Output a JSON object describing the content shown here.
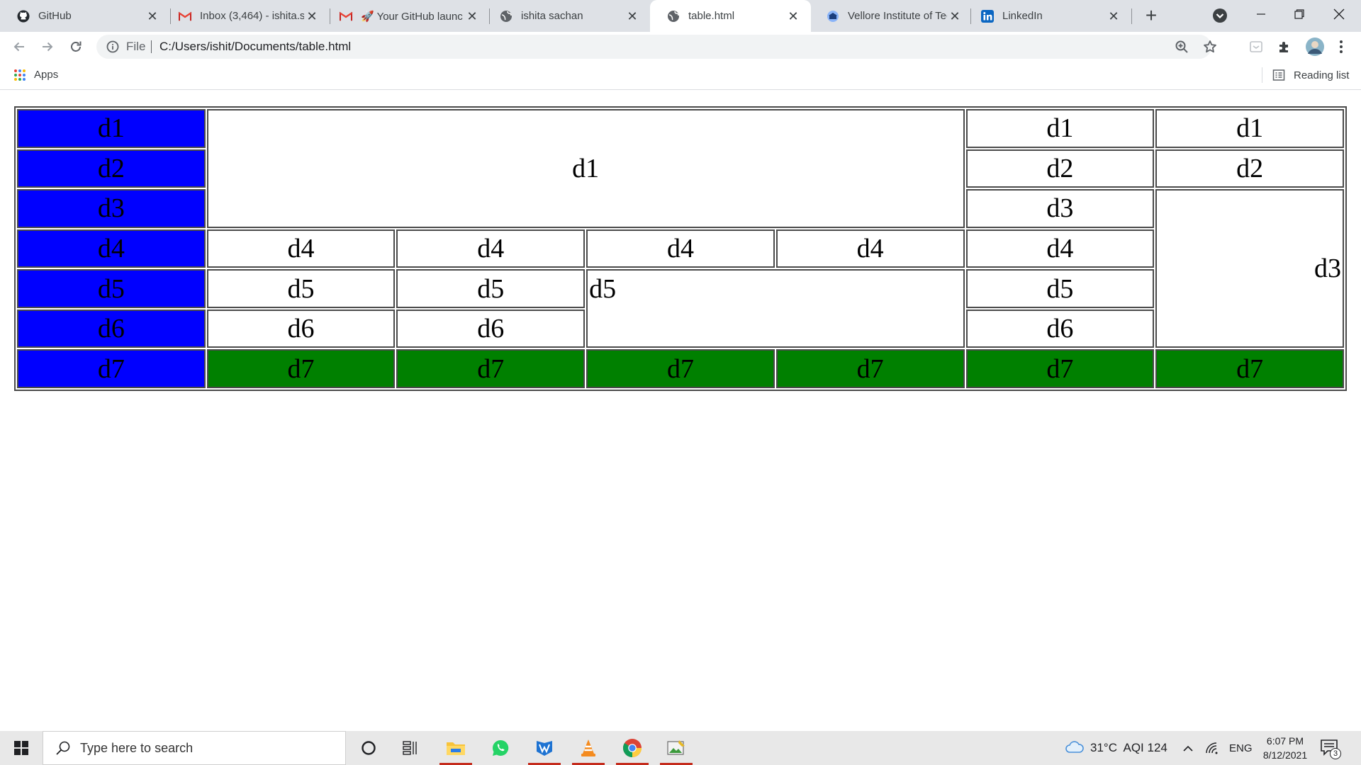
{
  "browser": {
    "tabs": [
      {
        "title": "GitHub",
        "favicon": "github-icon"
      },
      {
        "title": "Inbox (3,464) - ishita.s",
        "favicon": "gmail-icon"
      },
      {
        "title": "🚀 Your GitHub launc",
        "favicon": "gmail-icon"
      },
      {
        "title": "ishita sachan",
        "favicon": "globe-icon"
      },
      {
        "title": "table.html",
        "favicon": "globe-icon",
        "active": true
      },
      {
        "title": "Vellore Institute of Tec",
        "favicon": "vit-icon"
      },
      {
        "title": "LinkedIn",
        "favicon": "linkedin-icon"
      }
    ],
    "address": {
      "scheme_label": "File",
      "url": "C:/Users/ishit/Documents/table.html"
    },
    "bookmarks": {
      "apps_label": "Apps",
      "reading_list_label": "Reading list"
    }
  },
  "table": {
    "rows": [
      [
        "d1",
        "d1",
        "d1",
        "d1"
      ],
      [
        "d2",
        "d2",
        "d2"
      ],
      [
        "d3",
        "d3"
      ],
      [
        "d4",
        "d4",
        "d4",
        "d4",
        "d4",
        "d4",
        "d3"
      ],
      [
        "d5",
        "d5",
        "d5",
        "d5",
        "d5"
      ],
      [
        "d6",
        "d6",
        "d6",
        "d6"
      ],
      [
        "d7",
        "d7",
        "d7",
        "d7",
        "d7",
        "d7",
        "d7",
        "d7"
      ]
    ],
    "colors": {
      "first_column": "#0000ff",
      "last_row": "#008000",
      "border": "#4a4a4a"
    }
  },
  "taskbar": {
    "search_placeholder": "Type here to search",
    "weather": "31°C  AQI 124",
    "language": "ENG",
    "time": "6:07 PM",
    "date": "8/12/2021",
    "notification_count": "3"
  }
}
